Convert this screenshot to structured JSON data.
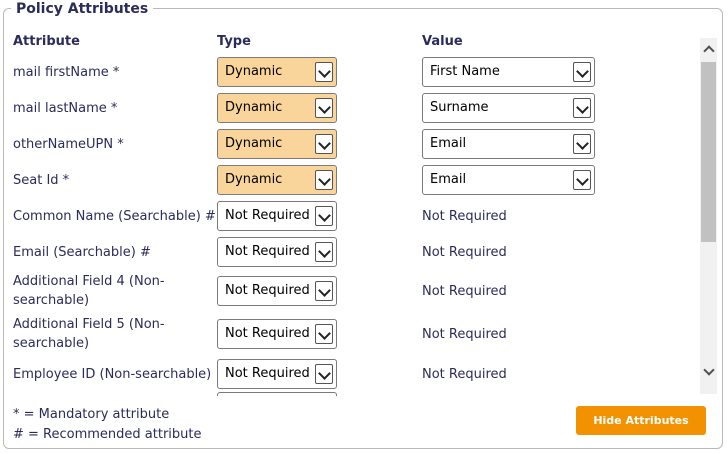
{
  "panel": {
    "title": "Policy Attributes",
    "headers": {
      "attribute": "Attribute",
      "type": "Type",
      "value": "Value"
    },
    "rows": [
      {
        "attribute": "mail firstName *",
        "type": "Dynamic",
        "value": "First Name"
      },
      {
        "attribute": "mail lastName *",
        "type": "Dynamic",
        "value": "Surname"
      },
      {
        "attribute": "otherNameUPN *",
        "type": "Dynamic",
        "value": "Email"
      },
      {
        "attribute": "Seat Id *",
        "type": "Dynamic",
        "value": "Email"
      },
      {
        "attribute": "Common Name (Searchable) #",
        "type": "Not Required",
        "value": "Not Required"
      },
      {
        "attribute": "Email (Searchable) #",
        "type": "Not Required",
        "value": "Not Required"
      },
      {
        "attribute": "Additional Field 4 (Non-searchable)",
        "type": "Not Required",
        "value": "Not Required"
      },
      {
        "attribute": "Additional Field 5 (Non-searchable)",
        "type": "Not Required",
        "value": "Not Required"
      },
      {
        "attribute": "Employee ID (Non-searchable)",
        "type": "Not Required",
        "value": "Not Required"
      }
    ],
    "notes": {
      "mandatory": "* = Mandatory attribute",
      "recommended": "# = Recommended attribute"
    },
    "hide_button": "Hide Attributes"
  },
  "colors": {
    "dynamic_bg": "#fad59b",
    "button_bg": "#f39200",
    "text": "#2b2b5c"
  }
}
